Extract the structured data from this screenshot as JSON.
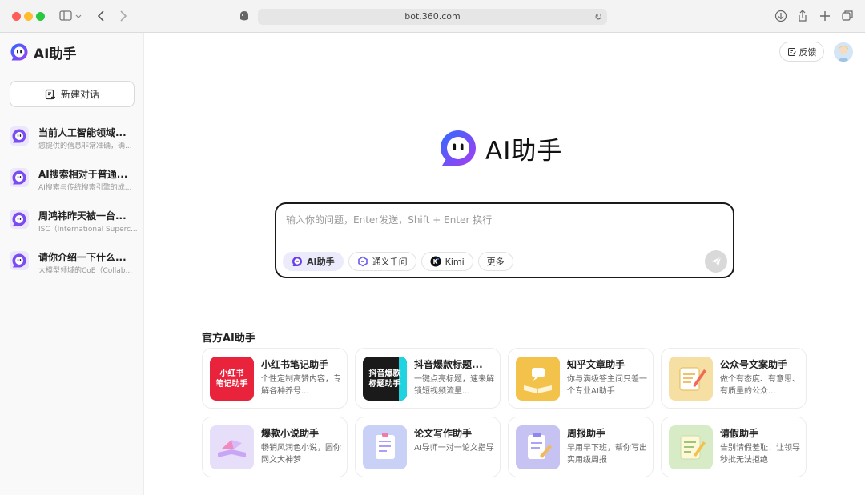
{
  "browser": {
    "url": "bot.360.com"
  },
  "sidebar": {
    "brand": "AI助手",
    "new_chat_label": "新建对话",
    "conversations": [
      {
        "title": "当前人工智能领域...",
        "subtitle": "您提供的信息非常准确，确..."
      },
      {
        "title": "AI搜索相对于普通...",
        "subtitle": "AI搜索与传统搜索引擎的成..."
      },
      {
        "title": "周鸿祎昨天被一台...",
        "subtitle": "ISC（International Superc..."
      },
      {
        "title": "请你介绍一下什么...",
        "subtitle": "大模型领域的CoE（Collab..."
      }
    ]
  },
  "header": {
    "feedback_label": "反馈"
  },
  "hero": {
    "title": "AI助手"
  },
  "input": {
    "placeholder": "输入你的问题，Enter发送，Shift + Enter 换行",
    "value": "",
    "models": [
      {
        "label": "AI助手",
        "icon": "ai-assistant-icon",
        "active": true
      },
      {
        "label": "通义千问",
        "icon": "tongyi-icon",
        "active": false
      },
      {
        "label": "Kimi",
        "icon": "kimi-icon",
        "active": false
      },
      {
        "label": "更多",
        "icon": "",
        "active": false
      }
    ]
  },
  "assistants": {
    "section_title": "官方AI助手",
    "cards": [
      {
        "title": "小红书笔记助手",
        "desc": "个性定制高赞内容，专解各种养号...",
        "thumb_text": "小红书\n笔记助手",
        "thumb_color": "#e8233b"
      },
      {
        "title": "抖音爆款标题...",
        "desc": "一键点亮标题，速来解锁短视频流量...",
        "thumb_text": "抖音爆款\n标题助手",
        "thumb_color": "#1a1a1a"
      },
      {
        "title": "知乎文章助手",
        "desc": "你与满级答主间只差一个专业AI助手",
        "thumb_text": "",
        "thumb_color": "#f3c24a"
      },
      {
        "title": "公众号文案助手",
        "desc": "做个有态度、有意思、有质量的公众...",
        "thumb_text": "",
        "thumb_color": "#f6dfa2"
      },
      {
        "title": "爆款小说助手",
        "desc": "畅销风润色小说，圆你网文大神梦",
        "thumb_text": "",
        "thumb_color": "#e7defa"
      },
      {
        "title": "论文写作助手",
        "desc": "AI导师一对一论文指导",
        "thumb_text": "",
        "thumb_color": "#c9d1f6"
      },
      {
        "title": "周报助手",
        "desc": "早用早下班，帮你写出实用级周报",
        "thumb_text": "",
        "thumb_color": "#c6c2f2"
      },
      {
        "title": "请假助手",
        "desc": "告别请假羞耻！让领导秒批无法拒绝",
        "thumb_text": "",
        "thumb_color": "#d7ecc6"
      }
    ]
  },
  "colors": {
    "brand_purple": "#6a3cf0",
    "brand_blue": "#2f6bff"
  }
}
